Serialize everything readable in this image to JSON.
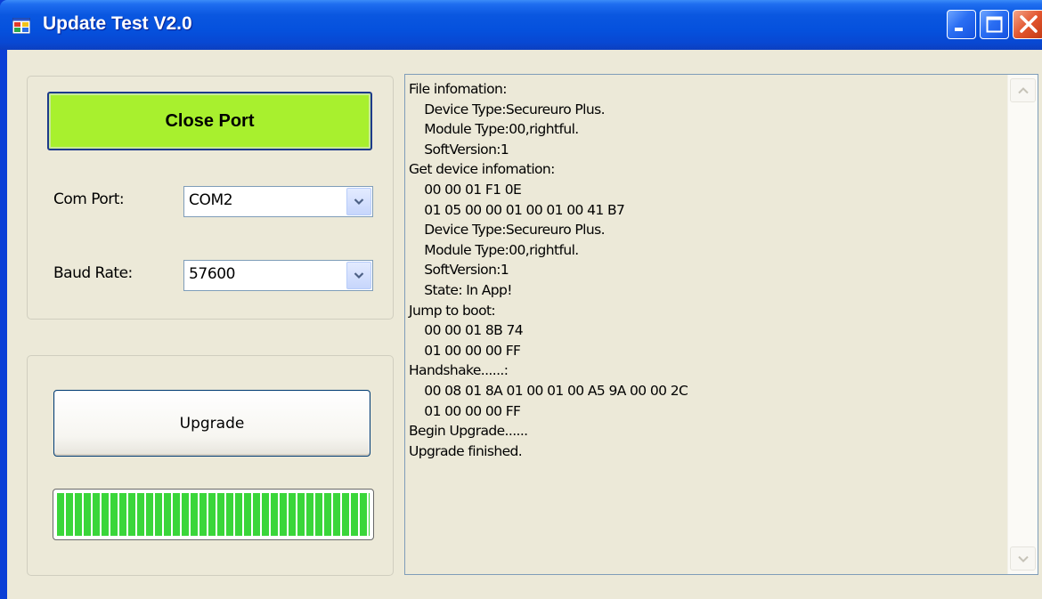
{
  "window": {
    "title": "Update Test V2.0"
  },
  "connection": {
    "close_port_label": "Close Port",
    "com_port_label": "Com Port:",
    "com_port_value": "COM2",
    "baud_rate_label": "Baud Rate:",
    "baud_rate_value": "57600"
  },
  "upgrade": {
    "button_label": "Upgrade",
    "progress_fraction": 1.0
  },
  "log": {
    "lines": [
      "File infomation:",
      "    Device Type:Secureuro Plus.",
      "    Module Type:00,rightful.",
      "    SoftVersion:1",
      "Get device infomation:",
      "    00 00 01 F1 0E",
      "    01 05 00 00 01 00 01 00 41 B7",
      "    Device Type:Secureuro Plus.",
      "    Module Type:00,rightful.",
      "    SoftVersion:1",
      "    State: In App!",
      "Jump to boot:",
      "    00 00 01 8B 74",
      "    01 00 00 00 FF",
      "Handshake......:",
      "    00 08 01 8A 01 00 01 00 A5 9A 00 00 2C",
      "    01 00 00 00 FF",
      "Begin Upgrade......",
      "Upgrade finished."
    ]
  },
  "icons": {
    "app": "app-window-icon",
    "minimize": "minimize-icon",
    "maximize": "maximize-icon",
    "close": "close-icon",
    "dropdown": "chevron-down-icon",
    "scroll_up": "scroll-up-arrow-icon",
    "scroll_down": "scroll-down-arrow-icon"
  },
  "colors": {
    "titlebar": "#0551dd",
    "close_port_bg": "#a8f02e",
    "progress_fill": "#3ad63a",
    "client_bg": "#ece9d8"
  }
}
